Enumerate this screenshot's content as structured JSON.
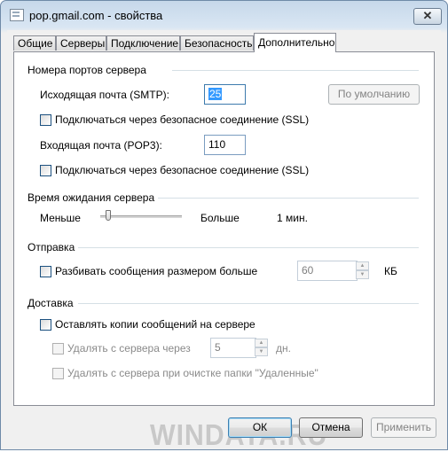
{
  "window": {
    "title": "pop.gmail.com - свойства",
    "close_symbol": "✕"
  },
  "tabs": [
    {
      "label": "Общие"
    },
    {
      "label": "Серверы"
    },
    {
      "label": "Подключение"
    },
    {
      "label": "Безопасность"
    },
    {
      "label": "Дополнительно",
      "active": true
    }
  ],
  "ports": {
    "group_title": "Номера портов сервера",
    "smtp_label": "Исходящая почта (SMTP):",
    "smtp_value": "25",
    "default_button": "По умолчанию",
    "smtp_ssl_label": "Подключаться через безопасное соединение (SSL)",
    "pop3_label": "Входящая почта (POP3):",
    "pop3_value": "110",
    "pop3_ssl_label": "Подключаться через безопасное соединение (SSL)"
  },
  "timeout": {
    "group_title": "Время ожидания сервера",
    "less_label": "Меньше",
    "more_label": "Больше",
    "value_label": "1 мин.",
    "slider_level": 0.07
  },
  "sending": {
    "group_title": "Отправка",
    "split_label": "Разбивать сообщения размером больше",
    "split_value": "60",
    "unit": "КБ"
  },
  "delivery": {
    "group_title": "Доставка",
    "keep_copies_label": "Оставлять копии сообщений на сервере",
    "remove_after_label": "Удалять с сервера через",
    "remove_after_value": "5",
    "days_unit": "дн.",
    "remove_on_empty_label": "Удалять с сервера при очистке папки \"Удаленные\""
  },
  "footer": {
    "ok": "ОК",
    "cancel": "Отмена",
    "apply": "Применить"
  },
  "watermark": "WINDATA.RU"
}
